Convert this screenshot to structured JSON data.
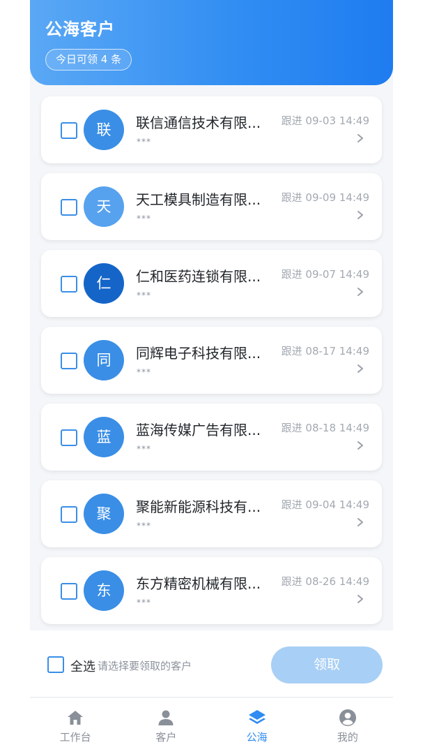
{
  "header": {
    "title": "公海客户",
    "quota": "今日可领 4 条"
  },
  "customers": [
    {
      "avatar": "联",
      "avatar_color": "#3a8ee6",
      "name": "联信通信技术有限...",
      "contact": "***",
      "follow": "跟进 09-03 14:49"
    },
    {
      "avatar": "天",
      "avatar_color": "#57a2ee",
      "name": "天工模具制造有限...",
      "contact": "***",
      "follow": "跟进 09-09 14:49"
    },
    {
      "avatar": "仁",
      "avatar_color": "#1565c9",
      "name": "仁和医药连锁有限...",
      "contact": "***",
      "follow": "跟进 09-07 14:49"
    },
    {
      "avatar": "同",
      "avatar_color": "#3a8ee6",
      "name": "同辉电子科技有限...",
      "contact": "***",
      "follow": "跟进 08-17 14:49"
    },
    {
      "avatar": "蓝",
      "avatar_color": "#3a8ee6",
      "name": "蓝海传媒广告有限...",
      "contact": "***",
      "follow": "跟进 08-18 14:49"
    },
    {
      "avatar": "聚",
      "avatar_color": "#3a8ee6",
      "name": "聚能新能源科技有...",
      "contact": "***",
      "follow": "跟进 09-04 14:49"
    },
    {
      "avatar": "东",
      "avatar_color": "#3a8ee6",
      "name": "东方精密机械有限...",
      "contact": "***",
      "follow": "跟进 08-26 14:49"
    }
  ],
  "bottom": {
    "select_all": "全选",
    "hint": "请选择要领取的客户",
    "claim": "领取"
  },
  "tabs": [
    {
      "label": "工作台",
      "icon": "home-icon",
      "active": false
    },
    {
      "label": "客户",
      "icon": "user-icon",
      "active": false
    },
    {
      "label": "公海",
      "icon": "layers-icon",
      "active": true
    },
    {
      "label": "我的",
      "icon": "account-circle-icon",
      "active": false
    }
  ],
  "colors": {
    "primary": "#2f8cf2",
    "claim_disabled": "#a8cff5"
  }
}
